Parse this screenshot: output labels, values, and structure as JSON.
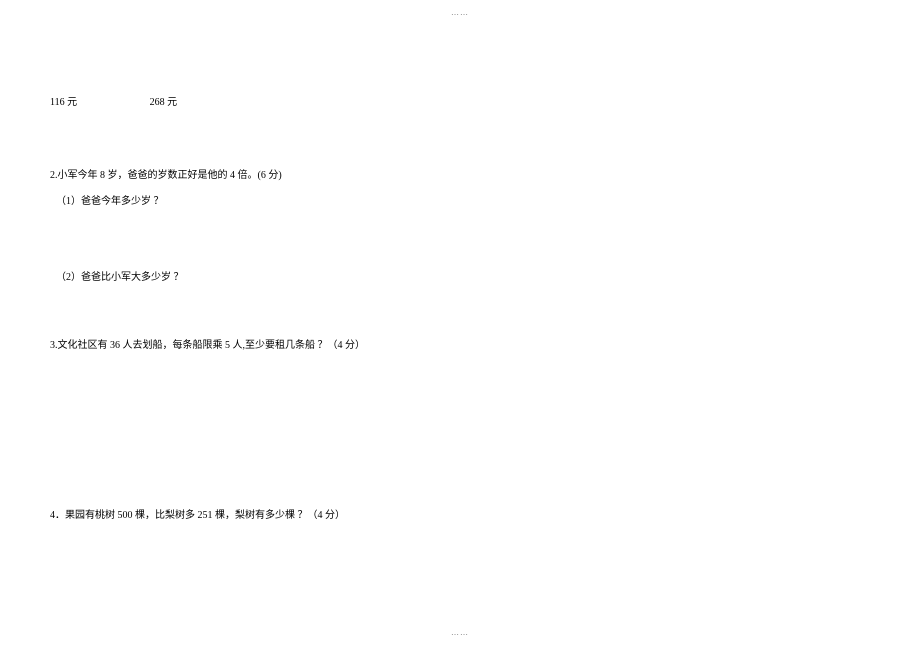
{
  "dots": "⋯⋯",
  "prices": {
    "price1": "116 元",
    "price2": "268 元"
  },
  "questions": {
    "q2": {
      "text": "2.小军今年 8 岁，爸爸的岁数正好是他的 4 倍。(6 分)",
      "sub1": "（1）爸爸今年多少岁 ？",
      "sub2": "（2）爸爸比小军大多少岁 ？"
    },
    "q3": {
      "text": "3.文化社区有 36 人去划船，每条船限乘 5 人,至少要租几条船 ？（4 分）"
    },
    "q4": {
      "text": "4．果园有桃树 500 棵，比梨树多 251 棵，梨树有多少棵 ？（4 分）"
    }
  }
}
